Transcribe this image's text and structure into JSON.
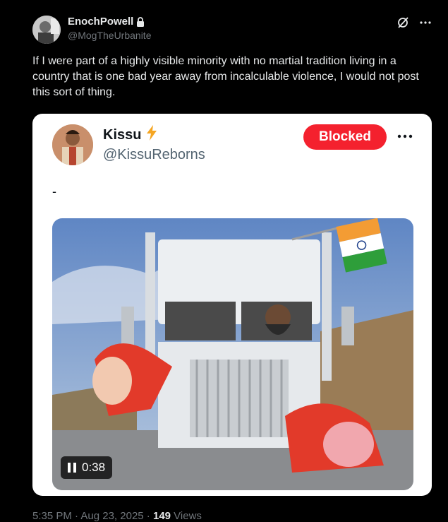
{
  "tweet": {
    "author": {
      "display_name": "EnochPowell",
      "handle": "@MogTheUrbanite",
      "verified_icon": "lock-icon"
    },
    "text": "If I were part of a highly visible minority with no martial tradition living in a country that is one bad year away from incalculable violence, I would not post this sort of thing.",
    "footer": {
      "time": "5:35 PM",
      "sep1": " · ",
      "date": "Aug 23, 2025",
      "sep2": " · ",
      "views_count": "149",
      "views_label": " Views"
    }
  },
  "quoted": {
    "display_name": "Kissu",
    "badge_icon": "lightning-icon",
    "handle": "@KissuReborns",
    "block_label": "Blocked",
    "text": "-",
    "video": {
      "duration": "0:38",
      "control_icon": "pause-icon"
    }
  },
  "colors": {
    "accent": "#f4212e",
    "background": "#000000",
    "card": "#ffffff"
  }
}
